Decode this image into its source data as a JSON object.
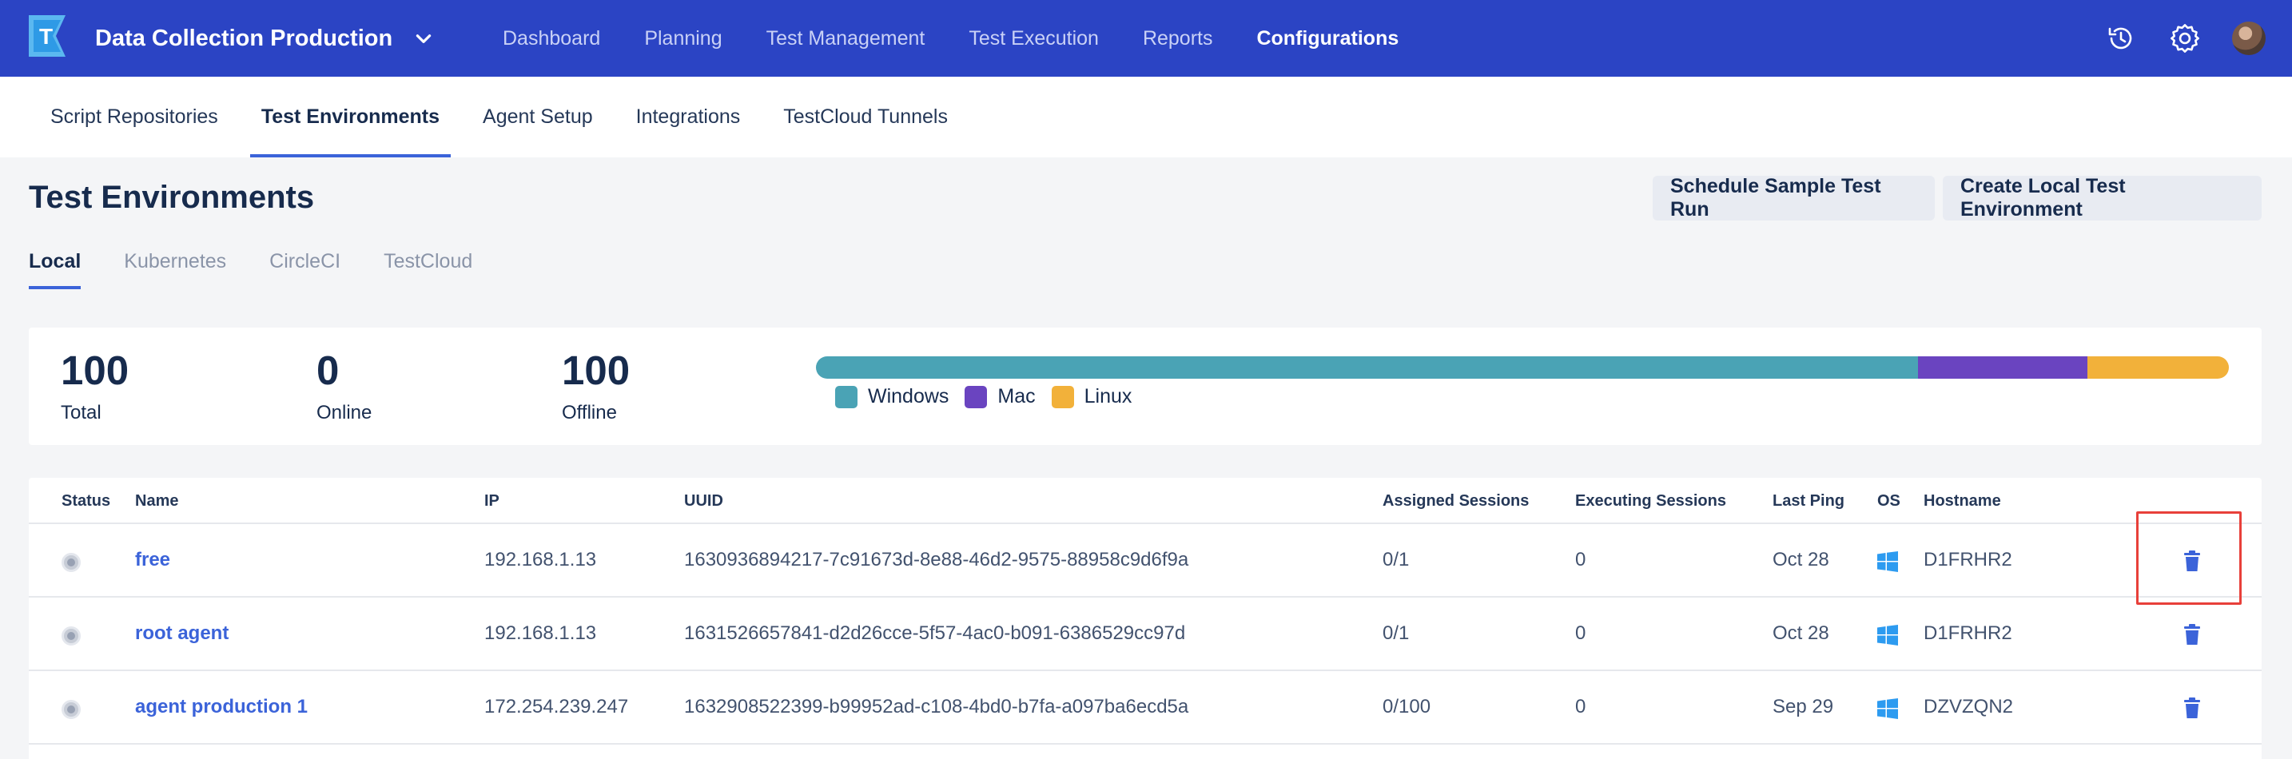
{
  "topbar": {
    "project_name": "Data Collection Production",
    "nav": [
      {
        "label": "Dashboard",
        "active": false
      },
      {
        "label": "Planning",
        "active": false
      },
      {
        "label": "Test Management",
        "active": false
      },
      {
        "label": "Test Execution",
        "active": false
      },
      {
        "label": "Reports",
        "active": false
      },
      {
        "label": "Configurations",
        "active": true
      }
    ],
    "icons": [
      "history-icon",
      "gear-icon",
      "avatar"
    ]
  },
  "subnav": [
    {
      "label": "Script Repositories",
      "active": false
    },
    {
      "label": "Test Environments",
      "active": true
    },
    {
      "label": "Agent Setup",
      "active": false
    },
    {
      "label": "Integrations",
      "active": false
    },
    {
      "label": "TestCloud Tunnels",
      "active": false
    }
  ],
  "page": {
    "title": "Test Environments",
    "schedule_button": "Schedule Sample Test Run",
    "create_button": "Create Local Test Environment"
  },
  "env_tabs": [
    {
      "label": "Local",
      "active": true
    },
    {
      "label": "Kubernetes",
      "active": false
    },
    {
      "label": "CircleCI",
      "active": false
    },
    {
      "label": "TestCloud",
      "active": false
    }
  ],
  "summary": {
    "total": {
      "value": "100",
      "label": "Total"
    },
    "online": {
      "value": "0",
      "label": "Online"
    },
    "offline": {
      "value": "100",
      "label": "Offline"
    },
    "os_distribution": [
      {
        "label": "Windows",
        "share": 0.78,
        "color": "#4aa3b5"
      },
      {
        "label": "Mac",
        "share": 0.12,
        "color": "#6a44c0"
      },
      {
        "label": "Linux",
        "share": 0.1,
        "color": "#f2b13a"
      }
    ]
  },
  "table": {
    "headers": {
      "status": "Status",
      "name": "Name",
      "ip": "IP",
      "uuid": "UUID",
      "assigned": "Assigned Sessions",
      "executing": "Executing Sessions",
      "last_ping": "Last Ping",
      "os": "OS",
      "hostname": "Hostname"
    },
    "rows": [
      {
        "name": "free",
        "ip": "192.168.1.13",
        "uuid": "1630936894217-7c91673d-8e88-46d2-9575-88958c9d6f9a",
        "assigned": "0/1",
        "executing": "0",
        "last_ping": "Oct 28",
        "os": "windows-icon",
        "hostname": "D1FRHR2"
      },
      {
        "name": "root agent",
        "ip": "192.168.1.13",
        "uuid": "1631526657841-d2d26cce-5f57-4ac0-b091-6386529cc97d",
        "assigned": "0/1",
        "executing": "0",
        "last_ping": "Oct 28",
        "os": "windows-icon",
        "hostname": "D1FRHR2"
      },
      {
        "name": "agent production 1",
        "ip": "172.254.239.247",
        "uuid": "1632908522399-b99952ad-c108-4bd0-b7fa-a097ba6ecd5a",
        "assigned": "0/100",
        "executing": "0",
        "last_ping": "Sep 29",
        "os": "windows-icon",
        "hostname": "DZVZQN2"
      }
    ]
  },
  "colors": {
    "topbar": "#2b44c4",
    "accent": "#3b63d9",
    "delete_icon": "#3b63d9",
    "highlight": "#e8403a"
  }
}
